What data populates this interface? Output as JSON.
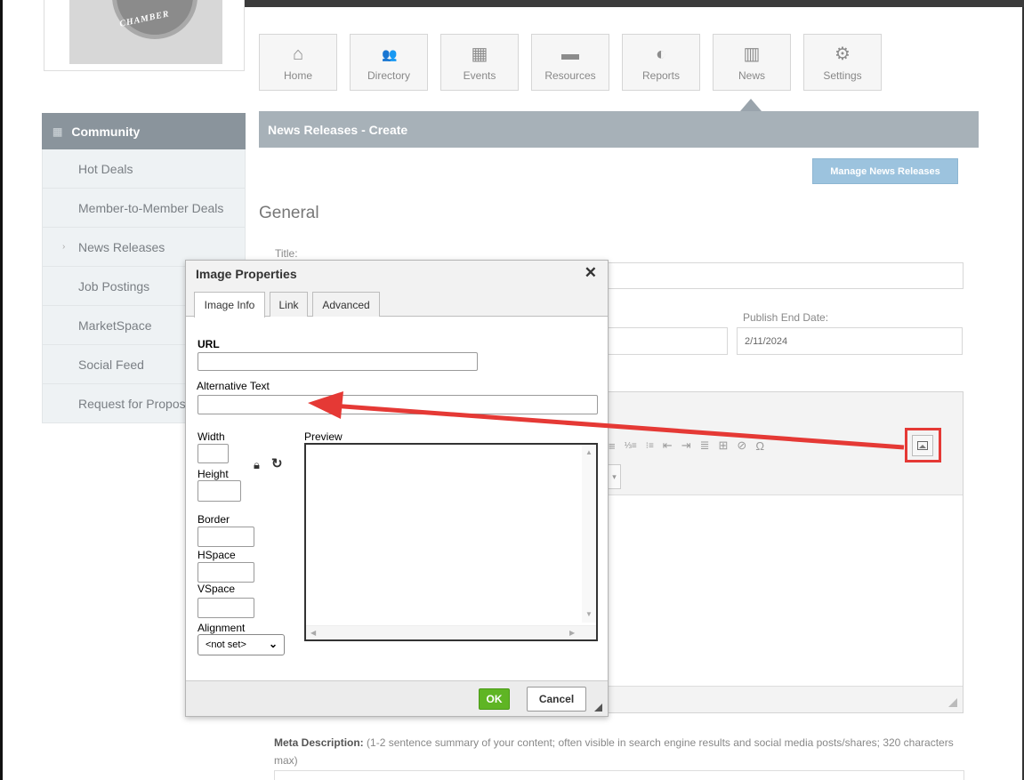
{
  "logo": {
    "text": "CHAMBER"
  },
  "nav": [
    {
      "icon": "home-icon",
      "glyph": "⌂",
      "label": "Home"
    },
    {
      "icon": "directory-icon",
      "glyph": "👥",
      "label": "Directory"
    },
    {
      "icon": "events-icon",
      "glyph": "▦",
      "label": "Events"
    },
    {
      "icon": "resources-icon",
      "glyph": "▬",
      "label": "Resources"
    },
    {
      "icon": "reports-icon",
      "glyph": "◐",
      "label": "Reports"
    },
    {
      "icon": "news-icon",
      "glyph": "▥",
      "label": "News"
    },
    {
      "icon": "settings-icon",
      "glyph": "⚙",
      "label": "Settings"
    }
  ],
  "sidebar": {
    "title": "Community",
    "items": [
      {
        "label": "Hot Deals"
      },
      {
        "label": "Member-to-Member Deals"
      },
      {
        "label": "News Releases"
      },
      {
        "label": "Job Postings"
      },
      {
        "label": "MarketSpace"
      },
      {
        "label": "Social Feed"
      },
      {
        "label": "Request for Proposals"
      }
    ]
  },
  "page": {
    "title": "News Releases - Create",
    "manage_button": "Manage News Releases",
    "section": "General",
    "title_label": "Title:",
    "publish_end_label": "Publish End Date:",
    "publish_end_value": "2/11/2024",
    "meta_label": "Meta Description:",
    "meta_hint": "(1-2 sentence summary of your content; often visible in search engine results and social media posts/shares; 320 characters max)"
  },
  "toolbar": {
    "glyphs": [
      "≡",
      "⅓≡",
      "⁝≡",
      "⇤",
      "⇥",
      "≣",
      "⊞",
      "⊘",
      "Ω"
    ],
    "image_button_icon": "image-icon"
  },
  "dialog": {
    "title": "Image Properties",
    "tabs": [
      "Image Info",
      "Link",
      "Advanced"
    ],
    "url_label": "URL",
    "url_value": "",
    "alt_label": "Alternative Text",
    "alt_value": "",
    "width_label": "Width",
    "height_label": "Height",
    "border_label": "Border",
    "hspace_label": "HSpace",
    "vspace_label": "VSpace",
    "alignment_label": "Alignment",
    "alignment_value": "<not set>",
    "preview_label": "Preview",
    "ok": "OK",
    "cancel": "Cancel"
  },
  "colors": {
    "annotation": "#e53935",
    "ok_green": "#5fb524",
    "header_slate": "#a7b1b8",
    "sidebar_head": "#8a949c",
    "manage_blue": "#9cc3de"
  }
}
